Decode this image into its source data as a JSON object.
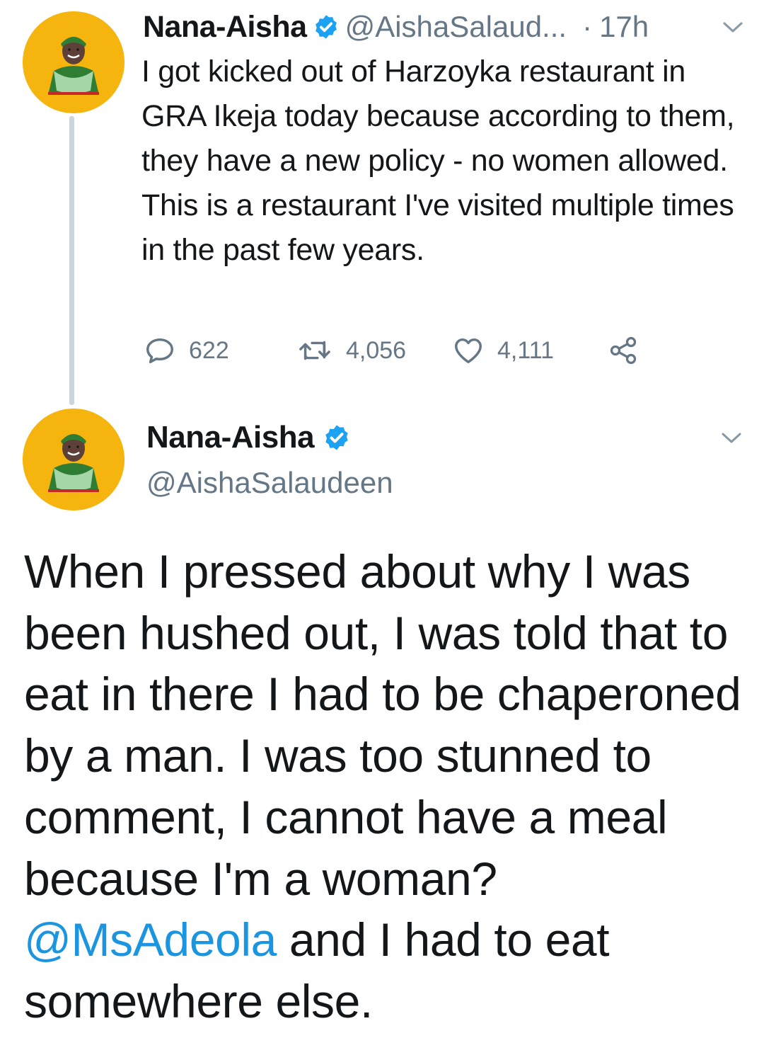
{
  "tweet1": {
    "author_name": "Nana-Aisha",
    "handle": "@AishaSalaud...",
    "separator": "·",
    "time": "17h",
    "text": "I got kicked out of Harzoyka restaurant in GRA Ikeja today because according to them, they have a new policy - no women allowed. This is a restaurant I've visited multiple times in the past few years.",
    "replies": "622",
    "retweets": "4,056",
    "likes": "4,111"
  },
  "tweet2": {
    "author_name": "Nana-Aisha",
    "handle": "@AishaSalaudeen",
    "text_before": "When I pressed about why I was been hushed out, I was told that to eat in there I had to be chaperoned by a man. I was too stunned to comment, I cannot have a meal because I'm a woman? ",
    "mention": "@MsAdeola",
    "text_after": " and I had to eat somewhere else."
  },
  "colors": {
    "text": "#14171a",
    "secondary": "#657786",
    "accent": "#1b95e0",
    "verified": "#1da1f2",
    "avatar_bg": "#f6b40e",
    "thread_line": "#cdd5dc"
  },
  "icons": [
    "avatar",
    "verified-badge-icon",
    "chevron-down-icon",
    "reply-icon",
    "retweet-icon",
    "like-icon",
    "share-icon"
  ]
}
